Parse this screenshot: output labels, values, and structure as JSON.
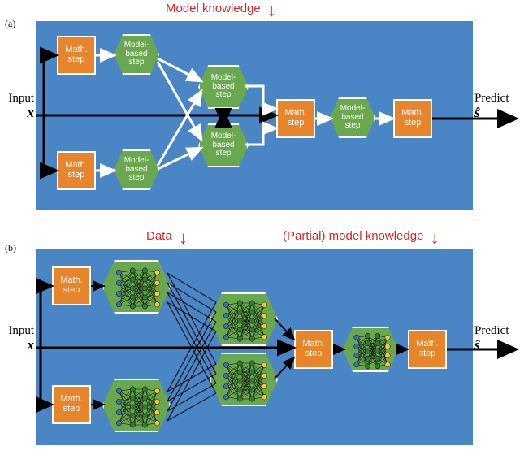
{
  "annotations": {
    "model_knowledge": "Model knowledge",
    "data": "Data",
    "partial_model_knowledge": "(Partial) model knowledge"
  },
  "panels": {
    "a": {
      "letter": "(a)",
      "input_label": "Input",
      "input_symbol": "x",
      "predict_label": "Predict",
      "predict_symbol": "ŝ",
      "math_label": "Math.\nstep",
      "model_label": "Model-\nbased\nstep"
    },
    "b": {
      "letter": "(b)",
      "input_label": "Input",
      "input_symbol": "x",
      "predict_label": "Predict",
      "predict_symbol": "ŝ",
      "math_label": "Math.\nstep"
    }
  },
  "chart_data": {
    "type": "diagram",
    "title": "Model-based vs DNN-augmented signal processing pipelines",
    "subfigures": [
      {
        "id": "a",
        "description": "Classical model-based pipeline: mathematical and model-based steps arranged as a DAG, fed by model knowledge",
        "external_inputs": [
          "Model knowledge",
          "Input x"
        ],
        "output": "Predict ŝ",
        "nodes": [
          {
            "id": "m1",
            "type": "math",
            "label": "Math. step",
            "row": "top"
          },
          {
            "id": "g1",
            "type": "model",
            "label": "Model-based step",
            "row": "top"
          },
          {
            "id": "m2",
            "type": "math",
            "label": "Math. step",
            "row": "bottom"
          },
          {
            "id": "g2",
            "type": "model",
            "label": "Model-based step",
            "row": "bottom"
          },
          {
            "id": "g3",
            "type": "model",
            "label": "Model-based step",
            "row": "mid-upper"
          },
          {
            "id": "g4",
            "type": "model",
            "label": "Model-based step",
            "row": "mid-lower"
          },
          {
            "id": "m3",
            "type": "math",
            "label": "Math. step",
            "row": "mid"
          },
          {
            "id": "g5",
            "type": "model",
            "label": "Model-based step",
            "row": "mid"
          },
          {
            "id": "m4",
            "type": "math",
            "label": "Math. step",
            "row": "mid"
          }
        ],
        "edges": [
          [
            "Input x",
            "m1"
          ],
          [
            "Input x",
            "m2"
          ],
          [
            "Input x",
            "g3"
          ],
          [
            "Input x",
            "g4"
          ],
          [
            "Input x",
            "m3"
          ],
          [
            "m1",
            "g1"
          ],
          [
            "m2",
            "g2"
          ],
          [
            "g1",
            "g3"
          ],
          [
            "g1",
            "g4"
          ],
          [
            "g2",
            "g3"
          ],
          [
            "g2",
            "g4"
          ],
          [
            "g3",
            "g4",
            "bidir"
          ],
          [
            "g3",
            "m3"
          ],
          [
            "g4",
            "m3"
          ],
          [
            "m3",
            "g5"
          ],
          [
            "g5",
            "m4"
          ],
          [
            "m4",
            "Predict ŝ"
          ]
        ]
      },
      {
        "id": "b",
        "description": "DNN-augmented pipeline: model-based steps replaced by small multilayer neural networks (blue input layer, two green hidden layers, yellow output layer); fed by data and partial model knowledge",
        "external_inputs": [
          "Data",
          "(Partial) model knowledge",
          "Input x"
        ],
        "output": "Predict ŝ",
        "nn_module": {
          "layers": 4,
          "layer_colors": [
            "blue",
            "green",
            "green",
            "yellow"
          ],
          "nodes_per_layer": [
            4,
            5,
            5,
            4
          ]
        },
        "nodes": [
          {
            "id": "m1",
            "type": "math",
            "row": "top"
          },
          {
            "id": "n1",
            "type": "nn",
            "row": "top"
          },
          {
            "id": "m2",
            "type": "math",
            "row": "bottom"
          },
          {
            "id": "n2",
            "type": "nn",
            "row": "bottom"
          },
          {
            "id": "n3",
            "type": "nn",
            "row": "mid-upper"
          },
          {
            "id": "n4",
            "type": "nn",
            "row": "mid-lower"
          },
          {
            "id": "m3",
            "type": "math",
            "row": "mid"
          },
          {
            "id": "n5",
            "type": "nn",
            "row": "mid"
          },
          {
            "id": "m4",
            "type": "math",
            "row": "mid"
          }
        ],
        "edges": [
          [
            "Input x",
            "m1"
          ],
          [
            "Input x",
            "m2"
          ],
          [
            "Input x",
            "n3"
          ],
          [
            "Input x",
            "n4"
          ],
          [
            "Input x",
            "m3"
          ],
          [
            "m1",
            "n1"
          ],
          [
            "m2",
            "n2"
          ],
          [
            "n1",
            "n3",
            "dense"
          ],
          [
            "n1",
            "n4",
            "dense"
          ],
          [
            "n2",
            "n3",
            "dense"
          ],
          [
            "n2",
            "n4",
            "dense"
          ],
          [
            "n3",
            "m3"
          ],
          [
            "n4",
            "m3"
          ],
          [
            "m3",
            "n5"
          ],
          [
            "n5",
            "m4"
          ],
          [
            "m4",
            "Predict ŝ"
          ]
        ]
      }
    ]
  }
}
